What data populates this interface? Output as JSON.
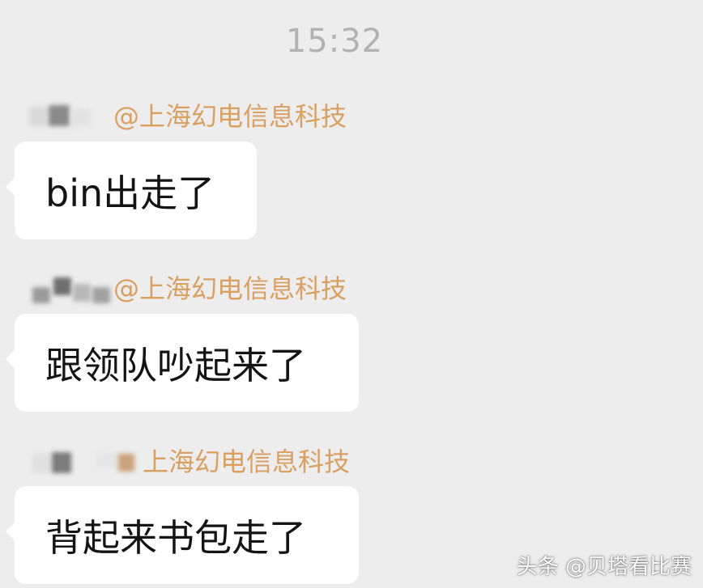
{
  "chat": {
    "timestamp": "15:32",
    "messages": [
      {
        "sender_label": "@上海幻电信息科技",
        "text": "bin出走了"
      },
      {
        "sender_label": "@上海幻电信息科技",
        "text": "跟领队吵起来了"
      },
      {
        "sender_label": "上海幻电信息科技",
        "text": "背起来书包走了"
      }
    ]
  },
  "watermark": {
    "text": "头条 @贝塔看比赛"
  },
  "colors": {
    "background": "#ededed",
    "bubble": "#ffffff",
    "sender_label": "#d9a062",
    "timestamp": "#b2b2b2",
    "message_text": "#141414"
  }
}
